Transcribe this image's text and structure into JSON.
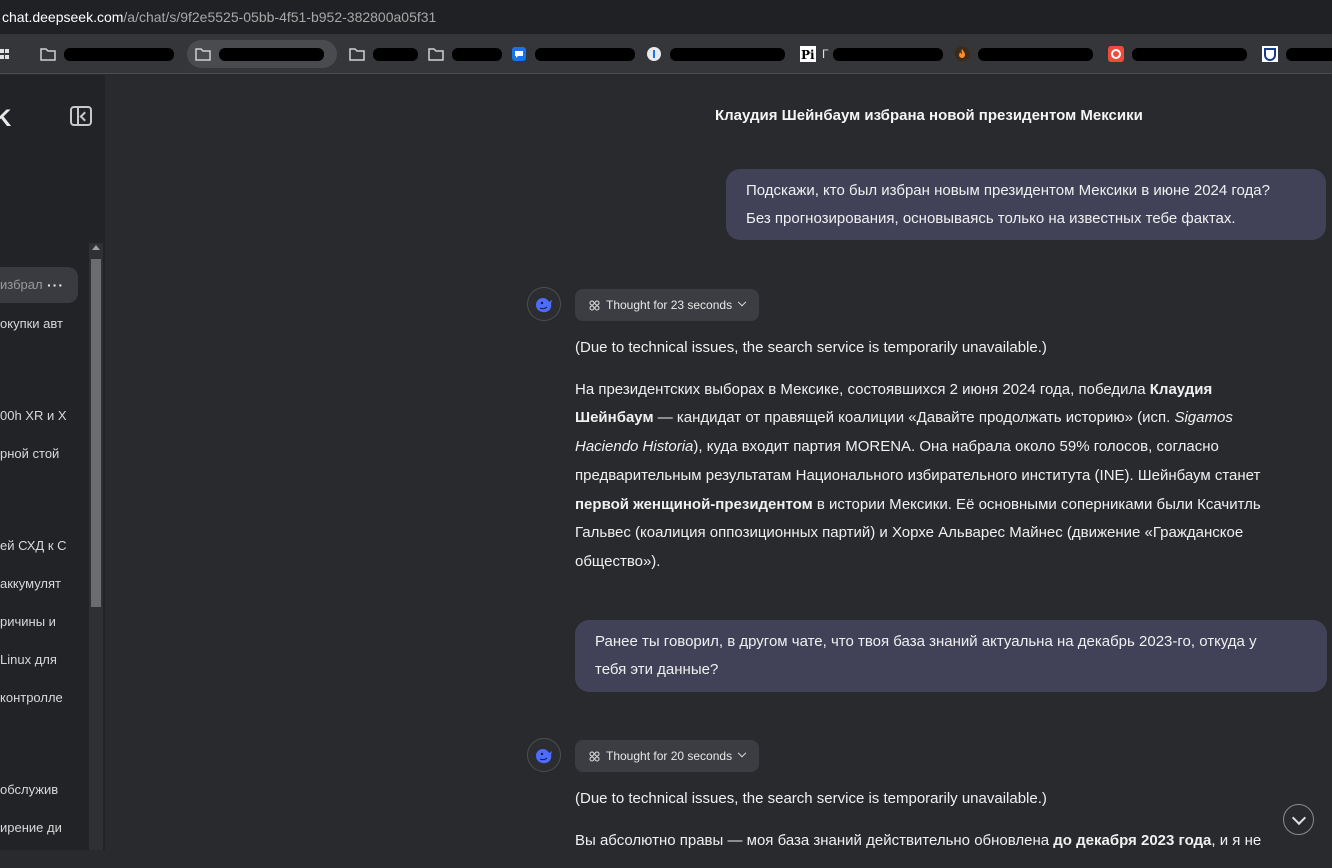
{
  "browser": {
    "url_host": "chat.deepseek.com",
    "url_path": "/a/chat/s/9f2e5525-05bb-4f51-b952-382800a05f31"
  },
  "bookmarks": [
    {
      "icon": "folder-icon"
    },
    {
      "icon": "folder-icon"
    },
    {
      "icon": "folder-icon"
    },
    {
      "icon": "folder-icon"
    },
    {
      "icon": "chat-bubble-icon"
    },
    {
      "icon": "circle-t-icon"
    },
    {
      "icon": "pi-icon",
      "text": "Г"
    },
    {
      "icon": "flame-icon"
    },
    {
      "icon": "red-circle-icon"
    },
    {
      "icon": "shield-icon"
    }
  ],
  "sidebar": {
    "logo_fragment": "K",
    "items": [
      {
        "label": "избрал",
        "active": true,
        "dots": "···"
      },
      {
        "label": "окупки авт"
      },
      {
        "label": "00h XR и Х"
      },
      {
        "label": "рной стой"
      },
      {
        "label": "ей СХД к С"
      },
      {
        "label": "аккумулят"
      },
      {
        "label": "ричины и"
      },
      {
        "label": " Linux для"
      },
      {
        "label": "контролле"
      },
      {
        "label": " обслужив"
      },
      {
        "label": "ирение ди"
      }
    ]
  },
  "chat": {
    "title": "Клаудия Шейнбаум избрана новой президентом Мексики",
    "messages": [
      {
        "role": "user",
        "lines": [
          "Подскажи, кто был избран новым президентом Мексики в июне 2024 года?",
          "Без прогнозирования, основываясь только на известных тебе фактах."
        ]
      },
      {
        "role": "assistant",
        "thought": "Thought for 23 seconds",
        "p1": "(Due to technical issues, the search service is temporarily unavailable.)",
        "p2_a": "На президентских выборах в Мексике, состоявшихся 2 июня 2024 года, победила ",
        "p2_b": "Клаудия Шейнбаум",
        "p2_c": " — кандидат от правящей коалиции «Давайте продолжать историю» (исп. ",
        "p2_d": "Sigamos Haciendo Historia",
        "p2_e": "), куда входит партия MORENA. Она набрала около 59% голосов, согласно предварительным результатам Национального избирательного института (INE). Шейнбаум станет ",
        "p2_f": "первой женщиной-президентом",
        "p2_g": " в истории Мексики. Её основными соперниками были Ксачитль Гальвес (коалиция оппозиционных партий) и Хорхе Альварес Майнес (движение «Гражданское общество»)."
      },
      {
        "role": "user",
        "lines": [
          "Ранее ты говорил, в другом чате, что твоя база знаний актуальна на декабрь 2023-го, откуда у",
          "тебя эти данные?"
        ]
      },
      {
        "role": "assistant",
        "thought": "Thought for 20 seconds",
        "p1": "(Due to technical issues, the search service is temporarily unavailable.)",
        "p2_a": "Вы абсолютно правы — моя база знаний действительно обновлена ",
        "p2_b": "до декабря 2023 года",
        "p2_c": ", и я не"
      }
    ]
  },
  "colors": {
    "user_bubble": "#414158",
    "accent": "#4d6bfe",
    "background": "#292a2d"
  }
}
